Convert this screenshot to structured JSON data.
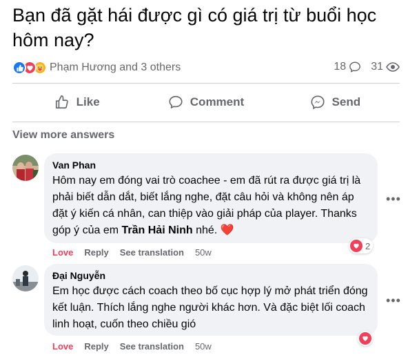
{
  "post": {
    "title": "Bạn đã gặt hái được gì có giá trị từ buổi học hôm nay?",
    "reaction_names": "Phạm Hương and 3 others",
    "comment_count": "18",
    "view_count": "31"
  },
  "actions": {
    "like": "Like",
    "comment": "Comment",
    "send": "Send"
  },
  "view_more": "View more answers",
  "comments": [
    {
      "author": "Van Phan",
      "text_before": "Hôm nay em đóng vai trò coachee - em đã rút ra được giá trị là phải biết dẫn dắt, biết lắng nghe, đặt câu hỏi và không nên áp đặt ý kiến cá nhân, can thiệp vào giải pháp của player. Thanks góp ý của em ",
      "mention": "Trần Hải Ninh",
      "text_after": " nhé. ",
      "emoji": "❤️",
      "love": "Love",
      "reply": "Reply",
      "see_translation": "See translation",
      "age": "50w",
      "reaction_count": "2"
    },
    {
      "author": "Đại Nguyễn",
      "text": "Em học được cách coach theo bố cục hợp lý mở phát triển đóng kết luận. Thích lắng nghe người khác hơn. Và đặc biệt lối coach linh hoạt, cuốn theo chiều gió",
      "love": "Love",
      "reply": "Reply",
      "see_translation": "See translation",
      "age": "50w"
    }
  ],
  "colors": {
    "like_blue": "#1877f2",
    "love_red": "#f33e58",
    "secondary_text": "#65676b",
    "bubble_bg": "#f0f2f5"
  }
}
